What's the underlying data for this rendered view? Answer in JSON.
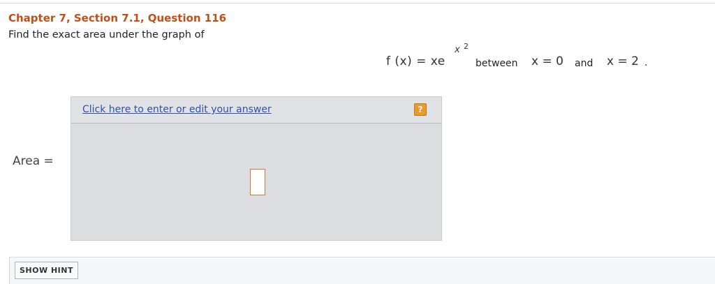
{
  "question": {
    "title": "Chapter 7, Section 7.1, Question 116",
    "prompt": "Find the exact area under the graph of"
  },
  "math": {
    "function_lhs": "f (x) = xe",
    "exponent_base": "x",
    "exponent_power": "2",
    "between_text": "between",
    "lower_bound": "x = 0",
    "and_text": "and",
    "upper_bound": "x = 2",
    "period": "."
  },
  "answer": {
    "label": "Area =",
    "edit_link": "Click here to enter or edit your answer",
    "help_icon_glyph": "?"
  },
  "footer": {
    "hint_button": "SHOW HINT"
  },
  "colors": {
    "title": "#c0501a",
    "link": "#2c53a8",
    "help_icon": "#e99a2e",
    "input_border": "#e0752f",
    "answer_panel": "#dcdde0"
  }
}
